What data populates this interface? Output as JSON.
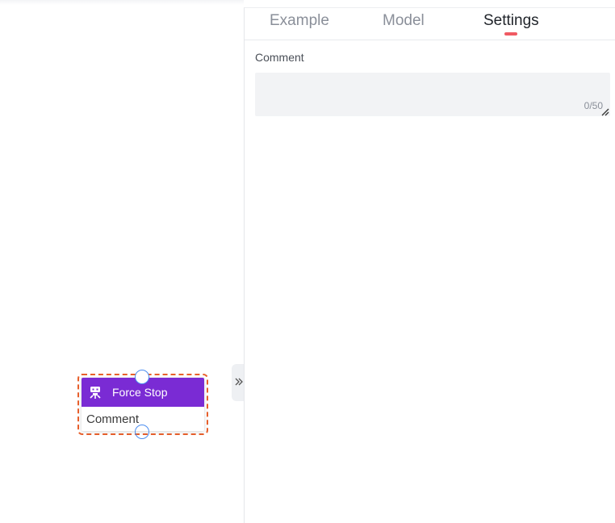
{
  "tabs": [
    {
      "label": "Example"
    },
    {
      "label": "Model"
    },
    {
      "label": "Settings"
    }
  ],
  "active_tab": "Settings",
  "settings": {
    "comment_label": "Comment",
    "comment_value": "",
    "comment_counter": "0/50"
  },
  "node": {
    "title": "Force Stop",
    "body": "Comment",
    "icon": "robot-stop-icon",
    "header_color": "#7a2bd4",
    "selection_color": "#e8602c"
  },
  "collapse_icon": "double-chevron-right-icon",
  "accent_color": "#f05a63"
}
